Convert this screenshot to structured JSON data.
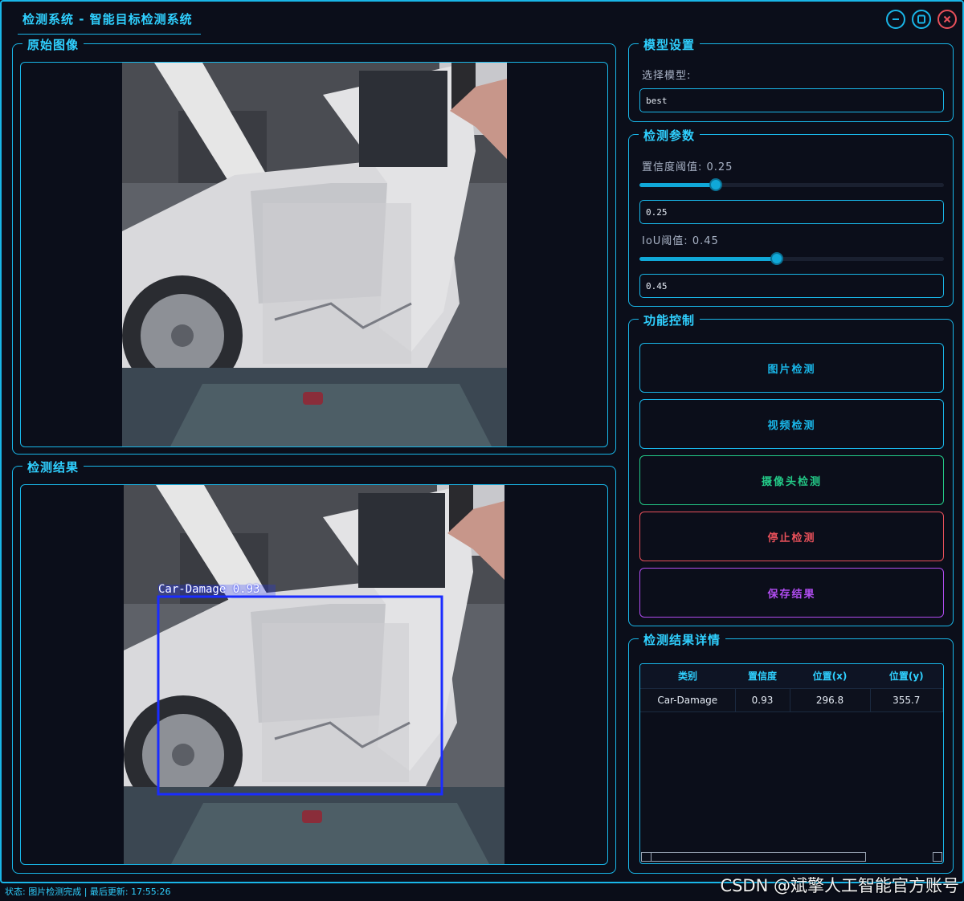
{
  "window": {
    "title": "检测系统 - 智能目标检测系统"
  },
  "original_panel": {
    "title": "原始图像"
  },
  "result_panel": {
    "title": "检测结果",
    "detection_label": "Car-Damage 0.93",
    "box_color": "#1a2cff"
  },
  "model_settings": {
    "title": "模型设置",
    "select_label": "选择模型:",
    "selected_model": "best"
  },
  "params": {
    "title": "检测参数",
    "conf_label": "置信度阈值: 0.25",
    "conf_value": "0.25",
    "conf_fraction": 0.25,
    "iou_label": "IoU阈值: 0.45",
    "iou_value": "0.45",
    "iou_fraction": 0.45
  },
  "controls": {
    "title": "功能控制",
    "image_detect": "图片检测",
    "video_detect": "视频检测",
    "camera_detect": "摄像头检测",
    "stop_detect": "停止检测",
    "save_result": "保存结果",
    "colors": {
      "image": "#19b6e8",
      "camera": "#23c987",
      "stop": "#e8505a",
      "save": "#b04cf0"
    }
  },
  "details": {
    "title": "检测结果详情",
    "columns": [
      "类别",
      "置信度",
      "位置(x)",
      "位置(y)"
    ],
    "rows": [
      [
        "Car-Damage",
        "0.93",
        "296.8",
        "355.7"
      ]
    ]
  },
  "status": {
    "text": "状态: 图片检测完成 | 最后更新: 17:55:26"
  },
  "watermark": "CSDN @斌擎人工智能官方账号",
  "icons": {
    "minimize": "minimize-icon",
    "maximize": "maximize-icon",
    "close": "close-icon"
  }
}
